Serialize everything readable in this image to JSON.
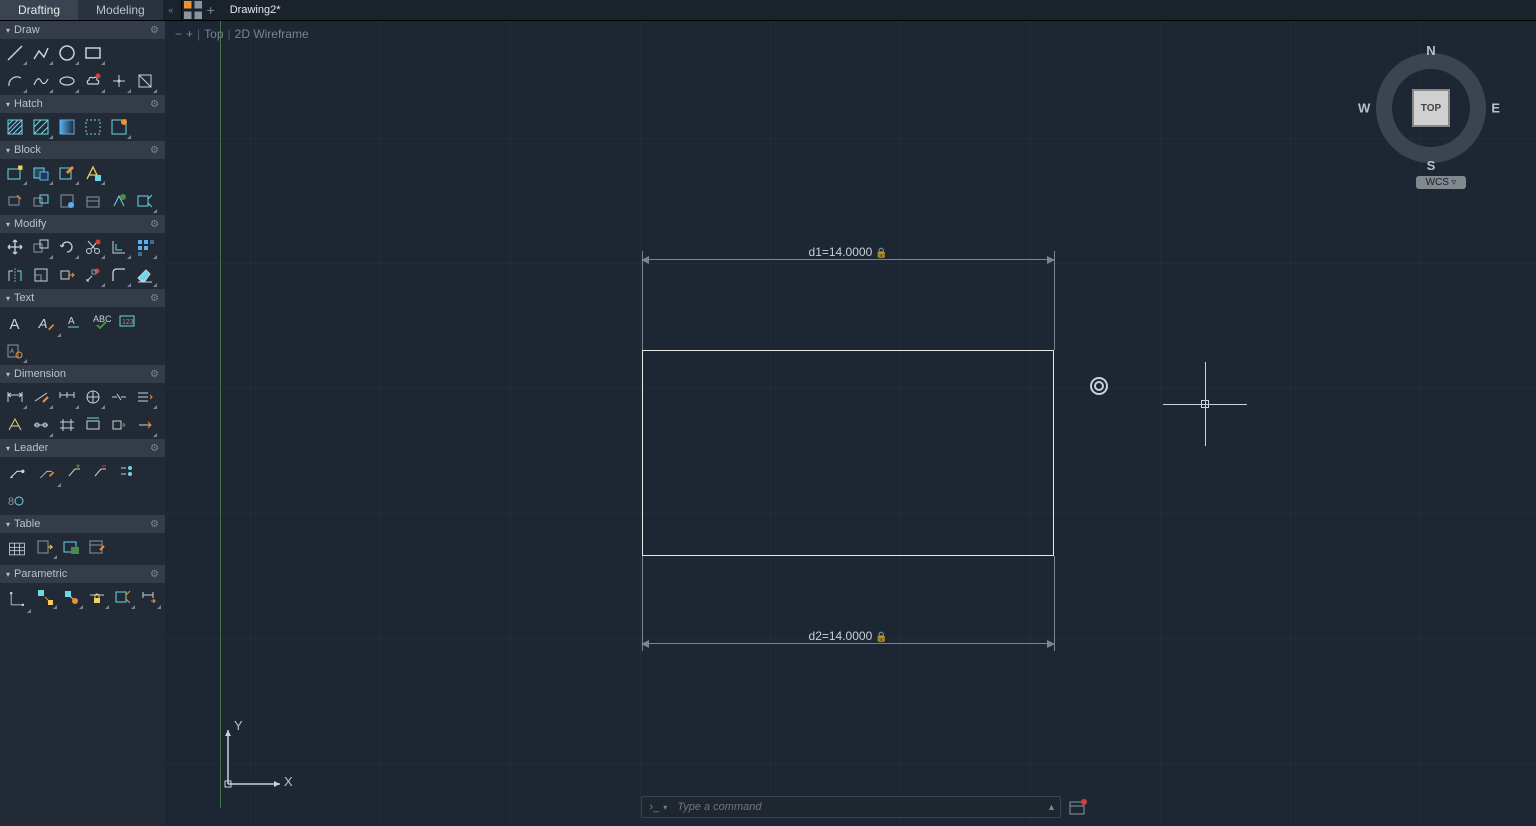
{
  "tabs": {
    "drafting": "Drafting",
    "modeling": "Modeling",
    "document": "Drawing2*"
  },
  "viewbar": {
    "minus": "−",
    "plus": "+",
    "top": "Top",
    "style": "2D Wireframe"
  },
  "panels": {
    "draw": "Draw",
    "hatch": "Hatch",
    "block": "Block",
    "modify": "Modify",
    "text": "Text",
    "dimension": "Dimension",
    "leader": "Leader",
    "table": "Table",
    "parametric": "Parametric"
  },
  "drawing": {
    "d1_label": "d1=14.0000",
    "d2_label": "d2=14.0000"
  },
  "navcube": {
    "n": "N",
    "s": "S",
    "e": "E",
    "w": "W",
    "face": "TOP",
    "wcs": "WCS"
  },
  "ucs": {
    "x": "X",
    "y": "Y"
  },
  "command": {
    "placeholder": "Type a command"
  }
}
